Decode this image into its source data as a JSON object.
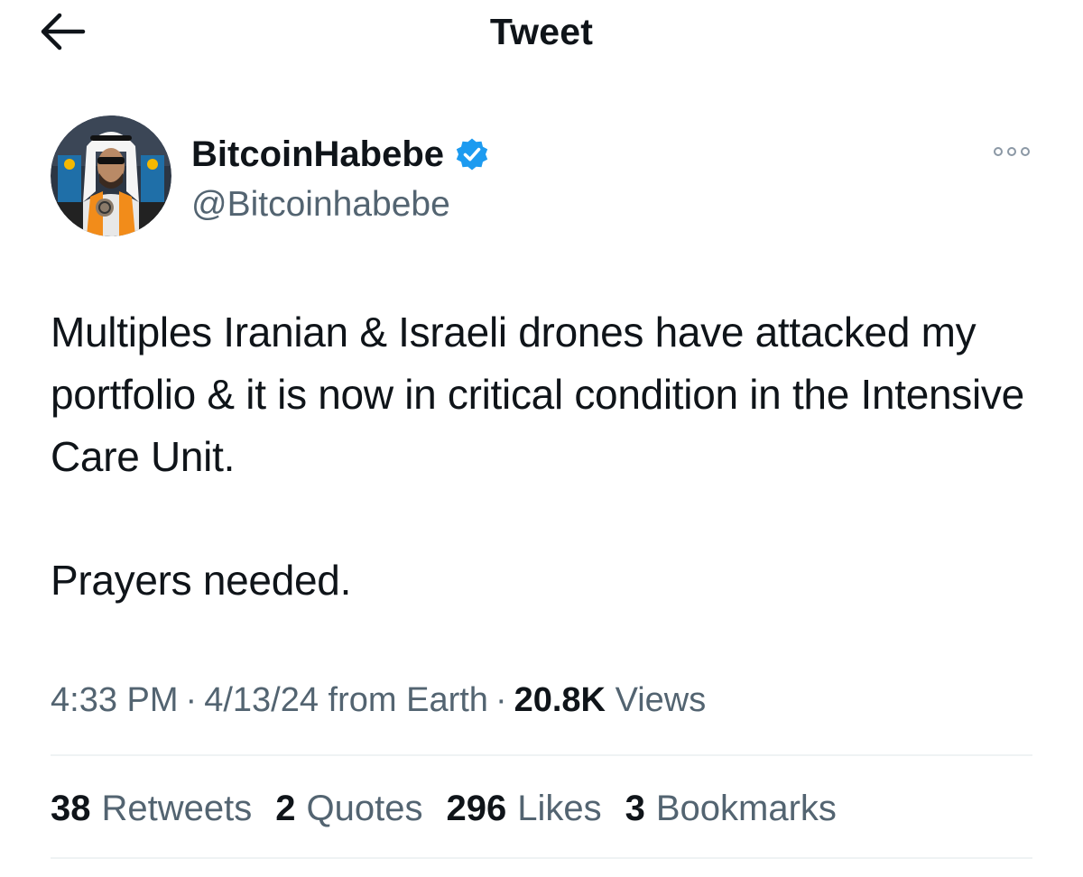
{
  "header": {
    "title": "Tweet",
    "back_icon": "arrow-left-icon"
  },
  "author": {
    "display_name": "BitcoinHabebe",
    "handle": "@Bitcoinhabebe",
    "verified": true,
    "verified_color": "#1d9bf0",
    "more_icon": "more-horizontal-icon"
  },
  "tweet": {
    "paragraphs": [
      "Multiples Iranian & Israeli drones have attacked my portfolio & it is now in critical condition in the Intensive Care Unit.",
      "Prayers needed."
    ]
  },
  "meta": {
    "time": "4:33 PM",
    "date": "4/13/24",
    "source": "from Earth",
    "separator": "·",
    "views_count": "20.8K",
    "views_label": "Views"
  },
  "stats": [
    {
      "count": "38",
      "label": "Retweets"
    },
    {
      "count": "2",
      "label": "Quotes"
    },
    {
      "count": "296",
      "label": "Likes"
    },
    {
      "count": "3",
      "label": "Bookmarks"
    }
  ],
  "colors": {
    "text": "#0f1419",
    "secondary_text": "#536471",
    "divider": "#eff3f4",
    "accent": "#1d9bf0"
  }
}
